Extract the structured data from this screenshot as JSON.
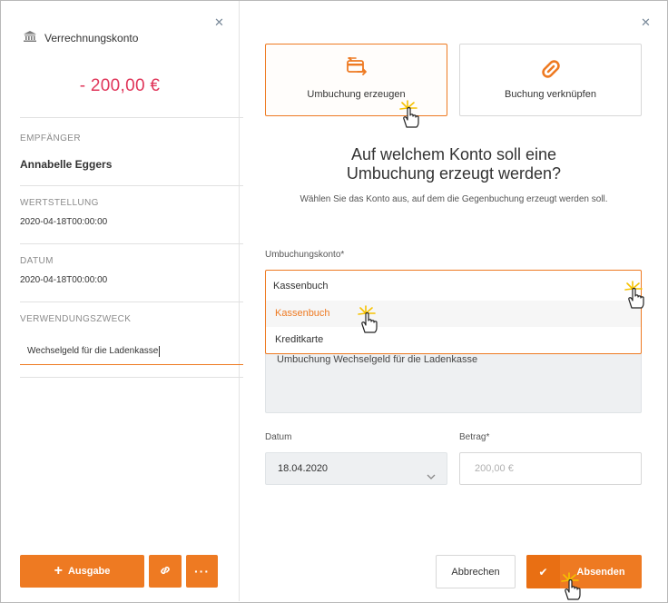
{
  "left_panel": {
    "account_icon": "bank-icon",
    "account_name": "Verrechnungskonto",
    "amount": "- 200,00 €",
    "recipient_label": "EMPFÄNGER",
    "recipient_value": "Annabelle Eggers",
    "value_date_label": "WERTSTELLUNG",
    "value_date": "2020-04-18T00:00:00",
    "date_label": "DATUM",
    "date_value": "2020-04-18T00:00:00",
    "purpose_label": "VERWENDUNGSZWECK",
    "purpose_value": "Wechselgeld für die Ladenkasse",
    "expense_button": "Ausgabe"
  },
  "right_panel": {
    "cards": [
      {
        "label": "Umbuchung erzeugen",
        "icon": "transfer-card-icon",
        "active": true
      },
      {
        "label": "Buchung verknüpfen",
        "icon": "link-icon",
        "active": false
      }
    ],
    "heading_line1": "Auf welchem Konto soll eine",
    "heading_line2": "Umbuchung erzeugt werden?",
    "subtext": "Wählen Sie das Konto aus, auf dem die Gegenbuchung erzeugt werden soll.",
    "account_field_label": "Umbuchungskonto*",
    "account_selected": "Kassenbuch",
    "account_options": [
      "Kassenbuch",
      "Kreditkarte"
    ],
    "purpose_text": "Umbuchung Wechselgeld für die Ladenkasse",
    "date_label": "Datum",
    "date_value": "18.04.2020",
    "amount_label": "Betrag*",
    "amount_placeholder": "200,00 €",
    "cancel_button": "Abbrechen",
    "submit_button": "Absenden"
  },
  "colors": {
    "accent": "#ee7a22",
    "negative_amount": "#e0365a"
  }
}
